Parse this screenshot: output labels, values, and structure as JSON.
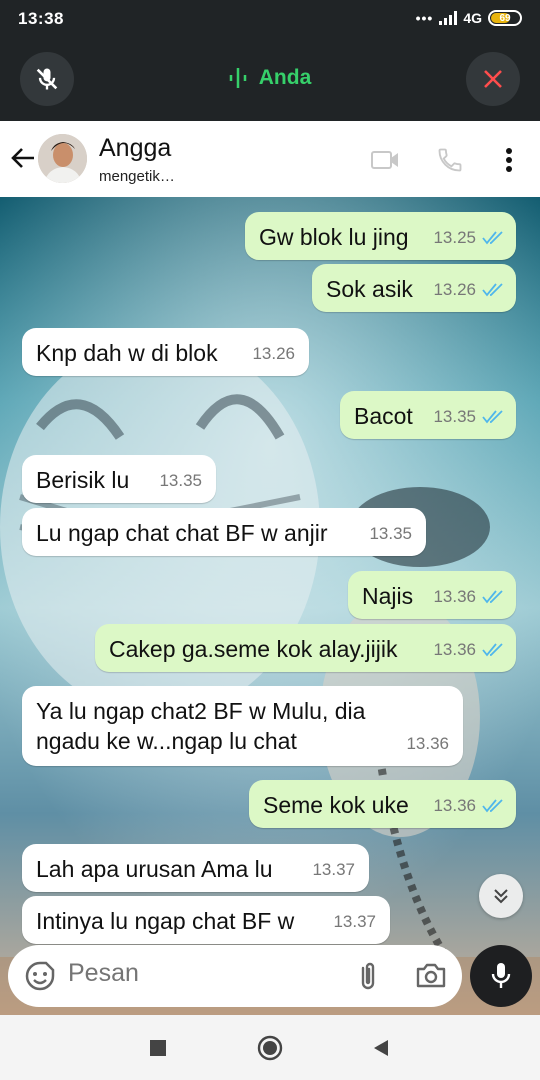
{
  "status_bar": {
    "time": "13:38",
    "network": "4G",
    "battery": "69",
    "battery_level": 0.69,
    "battery_color": "#e8b40e"
  },
  "call_bar": {
    "label": "Anda",
    "accent_color": "#36d06a",
    "mute_icon": "mic-off-icon",
    "end_icon": "close-icon"
  },
  "header": {
    "contact_name": "Angga",
    "status": "mengetik…",
    "icons": [
      "back-arrow-icon",
      "video-call-icon",
      "voice-call-icon",
      "more-vert-icon"
    ]
  },
  "messages": [
    {
      "dir": "out",
      "text": "Gw blok lu jing",
      "time": "13.25"
    },
    {
      "dir": "out",
      "text": "Sok asik",
      "time": "13.26"
    },
    {
      "dir": "in",
      "text": "Knp dah w di blok",
      "time": "13.26"
    },
    {
      "dir": "out",
      "text": "Bacot",
      "time": "13.35"
    },
    {
      "dir": "in",
      "text": "Berisik lu",
      "time": "13.35"
    },
    {
      "dir": "in",
      "text": "Lu ngap chat chat BF w anjir",
      "time": "13.35"
    },
    {
      "dir": "out",
      "text": "Najis",
      "time": "13.36"
    },
    {
      "dir": "out",
      "text": "Cakep ga.seme kok alay.jijik",
      "time": "13.36"
    },
    {
      "dir": "in",
      "text": "Ya lu ngap chat2 BF w Mulu, dia\nngadu ke w...ngap lu chat",
      "time": "13.36"
    },
    {
      "dir": "out",
      "text": "Seme kok uke",
      "time": "13.36"
    },
    {
      "dir": "in",
      "text": "Lah apa urusan Ama lu",
      "time": "13.37"
    },
    {
      "dir": "in",
      "text": "Intinya lu ngap chat BF w",
      "time": "13.37"
    }
  ],
  "colors": {
    "outgoing_bubble": "#dcf8c6",
    "incoming_bubble": "#ffffff",
    "read_tick": "#4fb6ec"
  },
  "composer": {
    "placeholder": "Pesan",
    "icons": [
      "emoji-icon",
      "attach-icon",
      "camera-icon",
      "mic-icon"
    ]
  },
  "navbar": {
    "icons": [
      "recents-square-icon",
      "home-circle-icon",
      "back-triangle-icon"
    ]
  }
}
